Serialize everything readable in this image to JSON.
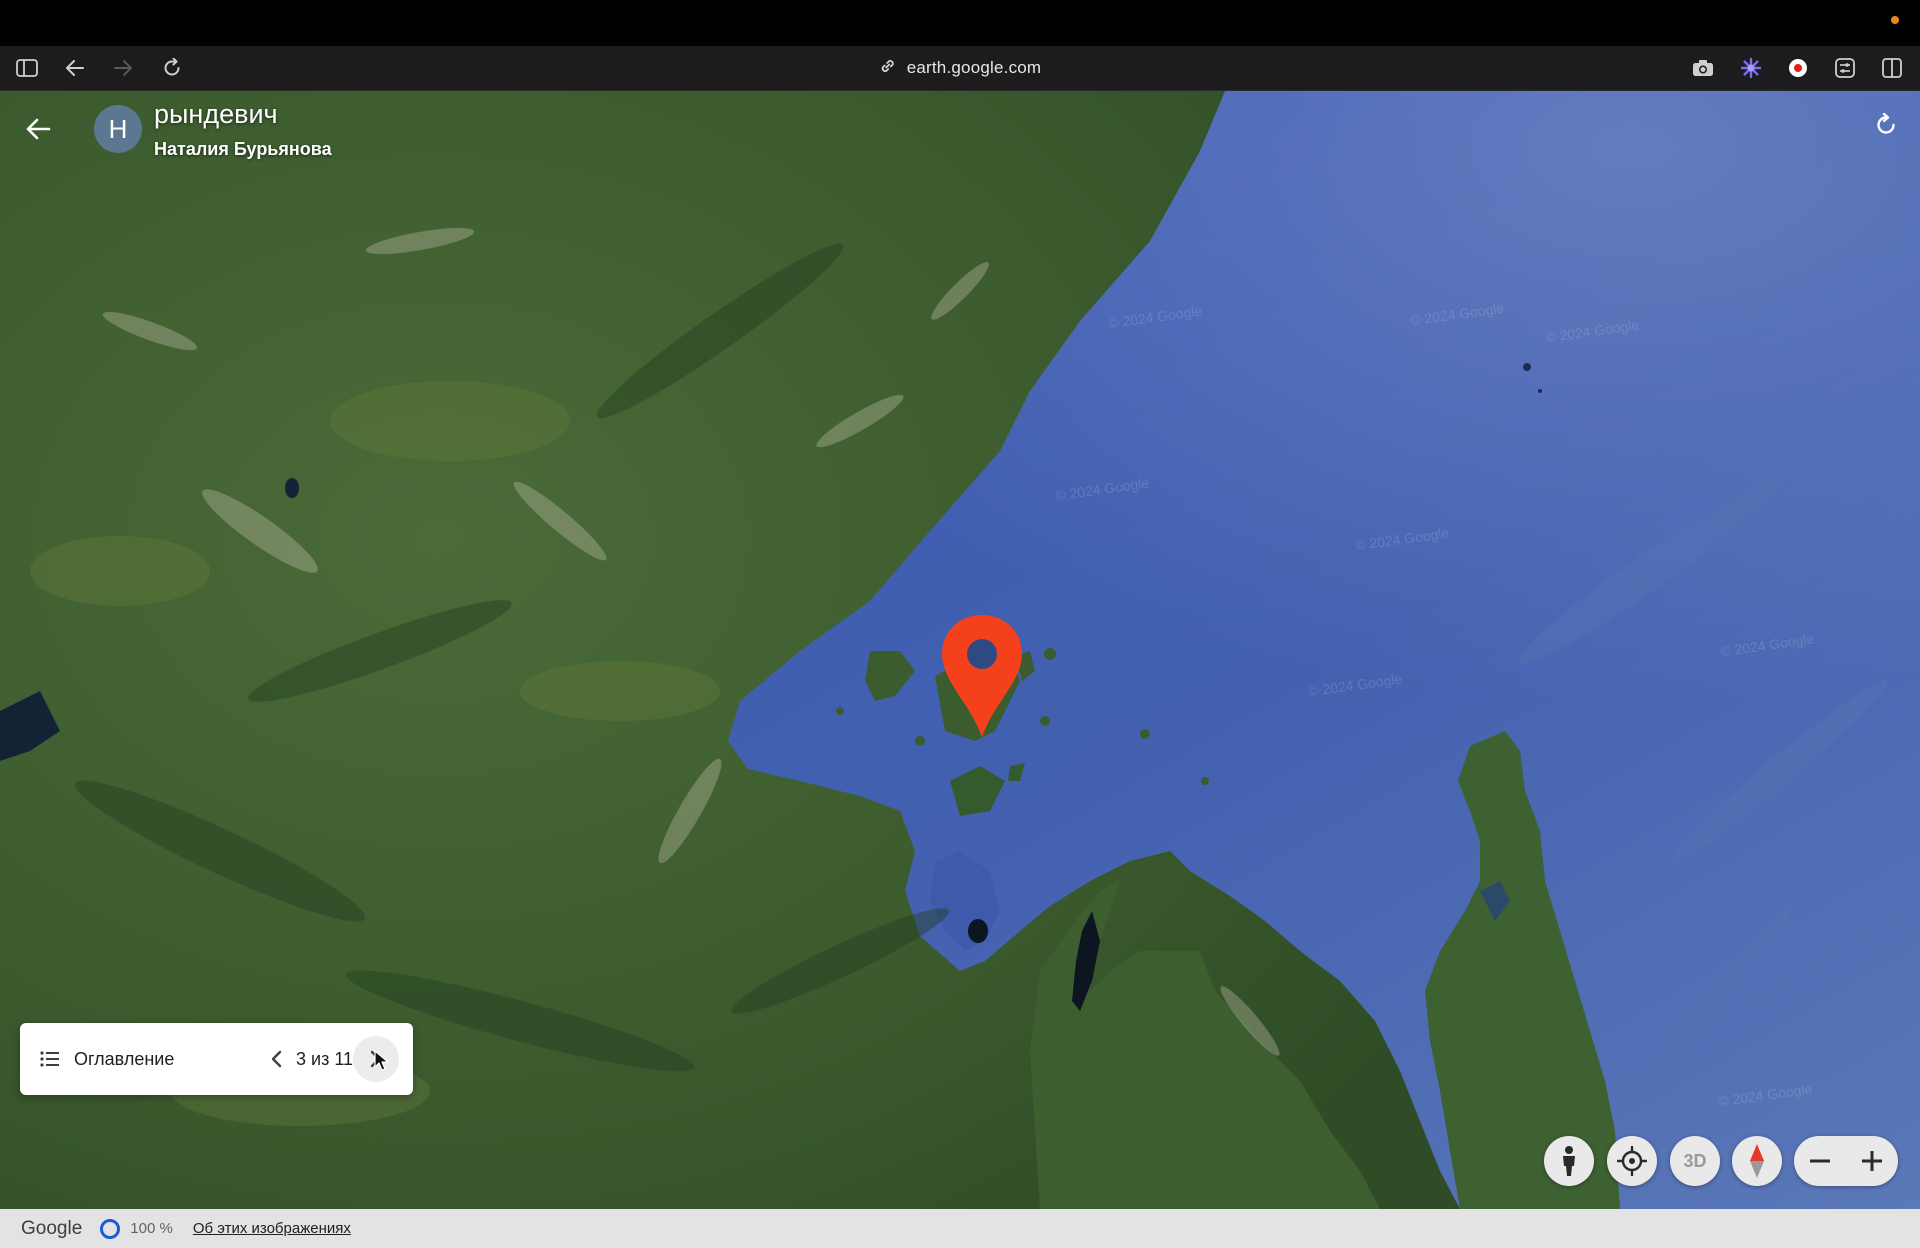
{
  "browser": {
    "url": "earth.google.com",
    "icons": [
      "sidebar-icon",
      "back-arrow-icon",
      "forward-arrow-icon",
      "reload-icon",
      "link-icon",
      "camera-icon",
      "extension-icon",
      "record-icon",
      "settings-icon",
      "split-view-icon"
    ]
  },
  "tour": {
    "avatar_letter": "Н",
    "title": "рындевич",
    "author": "Наталия Бурьянова"
  },
  "story_nav": {
    "toc_label": "Оглавление",
    "page_indicator": "3 из 11"
  },
  "map_controls": {
    "three_d_label": "3D",
    "icons": [
      "pegman-icon",
      "my-location-icon",
      "compass-icon",
      "zoom-out-icon",
      "zoom-in-icon"
    ]
  },
  "map": {
    "watermark": "© 2024 Google",
    "marker_color": "#f5411b",
    "water_color": "#3f5aa8",
    "land_color": "#3a5e2e"
  },
  "status_bar": {
    "logo": "Google",
    "zoom_level": "100 %",
    "about_link": "Об этих изображениях"
  }
}
